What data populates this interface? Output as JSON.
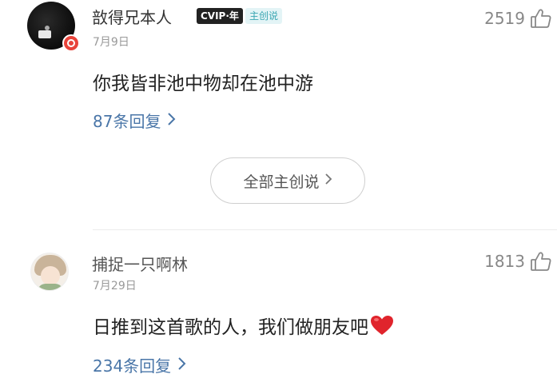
{
  "comments": [
    {
      "username": "敨得兄本人",
      "vip_label": "CVIP·年",
      "creator_label": "主创说",
      "date": "7月9日",
      "likes": "2519",
      "text": "你我皆非池中物却在池中游",
      "replies": "87条回复"
    },
    {
      "username": "捕捉一只啊林",
      "date": "7月29日",
      "likes": "1813",
      "text": "日推到这首歌的人，我们做朋友吧",
      "replies": "234条回复"
    }
  ],
  "all_creator_button": "全部主创说",
  "icons": {
    "like": "thumbs-up-icon",
    "chevron": "chevron-right-icon",
    "heart": "heart-icon",
    "badge": "red-ring-badge-icon"
  },
  "colors": {
    "link": "#4a76a8",
    "creator_badge_bg": "#e3f4f6",
    "creator_badge_text": "#3aa6b2",
    "heart": "#e0242c"
  }
}
